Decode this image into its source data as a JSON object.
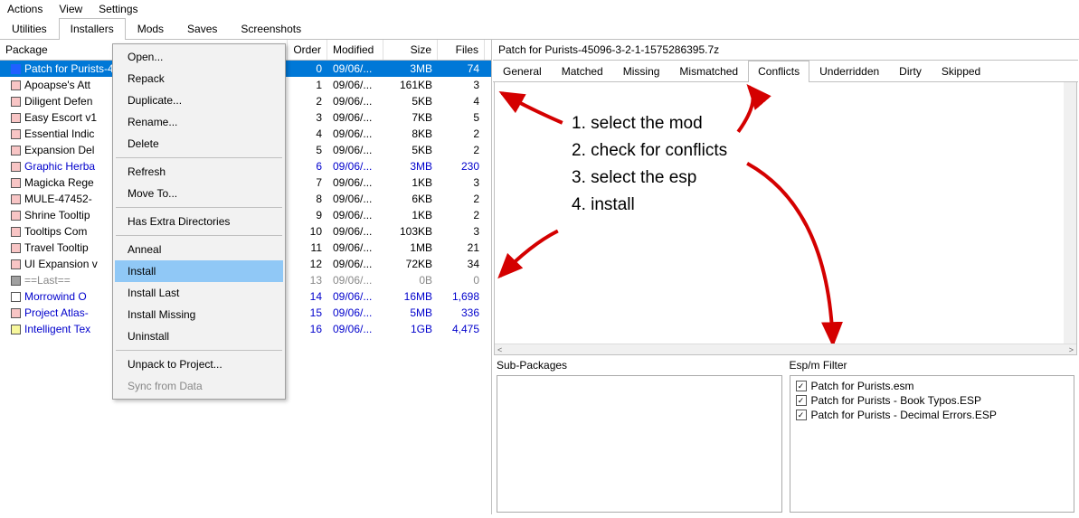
{
  "menubar": [
    "Actions",
    "View",
    "Settings"
  ],
  "main_tabs": [
    "Utilities",
    "Installers",
    "Mods",
    "Saves",
    "Screenshots"
  ],
  "main_tab_active": 1,
  "columns": {
    "package": "Package",
    "order": "Order",
    "modified": "Modified",
    "size": "Size",
    "files": "Files"
  },
  "packages": [
    {
      "chk": "blue",
      "name": "Patch for Purists-45096-3-2-1-1575286395.7z",
      "order": "0",
      "modified": "09/06/...",
      "size": "3MB",
      "files": "74",
      "sel": true,
      "txtcolor": ""
    },
    {
      "chk": "pink",
      "name": "Apoapse's Att",
      "order": "1",
      "modified": "09/06/...",
      "size": "161KB",
      "files": "3",
      "sel": false,
      "txtcolor": ""
    },
    {
      "chk": "pink",
      "name": "Diligent Defen",
      "order": "2",
      "modified": "09/06/...",
      "size": "5KB",
      "files": "4",
      "sel": false,
      "txtcolor": ""
    },
    {
      "chk": "pink",
      "name": "Easy Escort v1",
      "order": "3",
      "modified": "09/06/...",
      "size": "7KB",
      "files": "5",
      "sel": false,
      "txtcolor": ""
    },
    {
      "chk": "pink",
      "name": "Essential Indic",
      "order": "4",
      "modified": "09/06/...",
      "size": "8KB",
      "files": "2",
      "sel": false,
      "txtcolor": ""
    },
    {
      "chk": "pink",
      "name": "Expansion Del",
      "order": "5",
      "modified": "09/06/...",
      "size": "5KB",
      "files": "2",
      "sel": false,
      "txtcolor": ""
    },
    {
      "chk": "pink",
      "name": "Graphic Herba",
      "order": "6",
      "modified": "09/06/...",
      "size": "3MB",
      "files": "230",
      "sel": false,
      "txtcolor": "blue"
    },
    {
      "chk": "pink",
      "name": "Magicka Rege",
      "order": "7",
      "modified": "09/06/...",
      "size": "1KB",
      "files": "3",
      "sel": false,
      "txtcolor": ""
    },
    {
      "chk": "pink",
      "name": "MULE-47452-",
      "order": "8",
      "modified": "09/06/...",
      "size": "6KB",
      "files": "2",
      "sel": false,
      "txtcolor": ""
    },
    {
      "chk": "pink",
      "name": "Shrine Tooltip",
      "order": "9",
      "modified": "09/06/...",
      "size": "1KB",
      "files": "2",
      "sel": false,
      "txtcolor": ""
    },
    {
      "chk": "pink",
      "name": "Tooltips Com",
      "order": "10",
      "modified": "09/06/...",
      "size": "103KB",
      "files": "3",
      "sel": false,
      "txtcolor": ""
    },
    {
      "chk": "pink",
      "name": "Travel Tooltip",
      "order": "11",
      "modified": "09/06/...",
      "size": "1MB",
      "files": "21",
      "sel": false,
      "txtcolor": ""
    },
    {
      "chk": "pink",
      "name": "UI Expansion v",
      "order": "12",
      "modified": "09/06/...",
      "size": "72KB",
      "files": "34",
      "sel": false,
      "txtcolor": ""
    },
    {
      "chk": "grey",
      "name": "==Last==",
      "order": "13",
      "modified": "09/06/...",
      "size": "0B",
      "files": "0",
      "sel": false,
      "txtcolor": "grey"
    },
    {
      "chk": "white",
      "name": "Morrowind O",
      "order": "14",
      "modified": "09/06/...",
      "size": "16MB",
      "files": "1,698",
      "sel": false,
      "txtcolor": "blue"
    },
    {
      "chk": "pink",
      "name": "Project Atlas-",
      "order": "15",
      "modified": "09/06/...",
      "size": "5MB",
      "files": "336",
      "sel": false,
      "txtcolor": "blue"
    },
    {
      "chk": "yellow",
      "name": "Intelligent Tex",
      "order": "16",
      "modified": "09/06/...",
      "size": "1GB",
      "files": "4,475",
      "sel": false,
      "txtcolor": "blue"
    }
  ],
  "context_menu": [
    {
      "label": "Open...",
      "type": "item"
    },
    {
      "label": "Repack",
      "type": "item"
    },
    {
      "label": "Duplicate...",
      "type": "item"
    },
    {
      "label": "Rename...",
      "type": "item"
    },
    {
      "label": "Delete",
      "type": "item"
    },
    {
      "type": "sep"
    },
    {
      "label": "Refresh",
      "type": "item"
    },
    {
      "label": "Move To...",
      "type": "item"
    },
    {
      "type": "sep"
    },
    {
      "label": "Has Extra Directories",
      "type": "item"
    },
    {
      "type": "sep"
    },
    {
      "label": "Anneal",
      "type": "item"
    },
    {
      "label": "Install",
      "type": "item",
      "hover": true
    },
    {
      "label": "Install Last",
      "type": "item"
    },
    {
      "label": "Install Missing",
      "type": "item"
    },
    {
      "label": "Uninstall",
      "type": "item"
    },
    {
      "type": "sep"
    },
    {
      "label": "Unpack to Project...",
      "type": "item"
    },
    {
      "label": "Sync from Data",
      "type": "item",
      "disabled": true
    }
  ],
  "right_title": "Patch for Purists-45096-3-2-1-1575286395.7z",
  "right_tabs": [
    "General",
    "Matched",
    "Missing",
    "Mismatched",
    "Conflicts",
    "Underridden",
    "Dirty",
    "Skipped"
  ],
  "right_tab_active": 4,
  "annotations": [
    "1. select the mod",
    "2. check for conflicts",
    "3. select the esp",
    "4. install"
  ],
  "sub_packages_label": "Sub-Packages",
  "esp_filter_label": "Esp/m Filter",
  "esp_items": [
    {
      "checked": true,
      "label": "Patch for Purists.esm"
    },
    {
      "checked": true,
      "label": "Patch for Purists - Book Typos.ESP"
    },
    {
      "checked": true,
      "label": "Patch for Purists - Decimal Errors.ESP"
    }
  ]
}
